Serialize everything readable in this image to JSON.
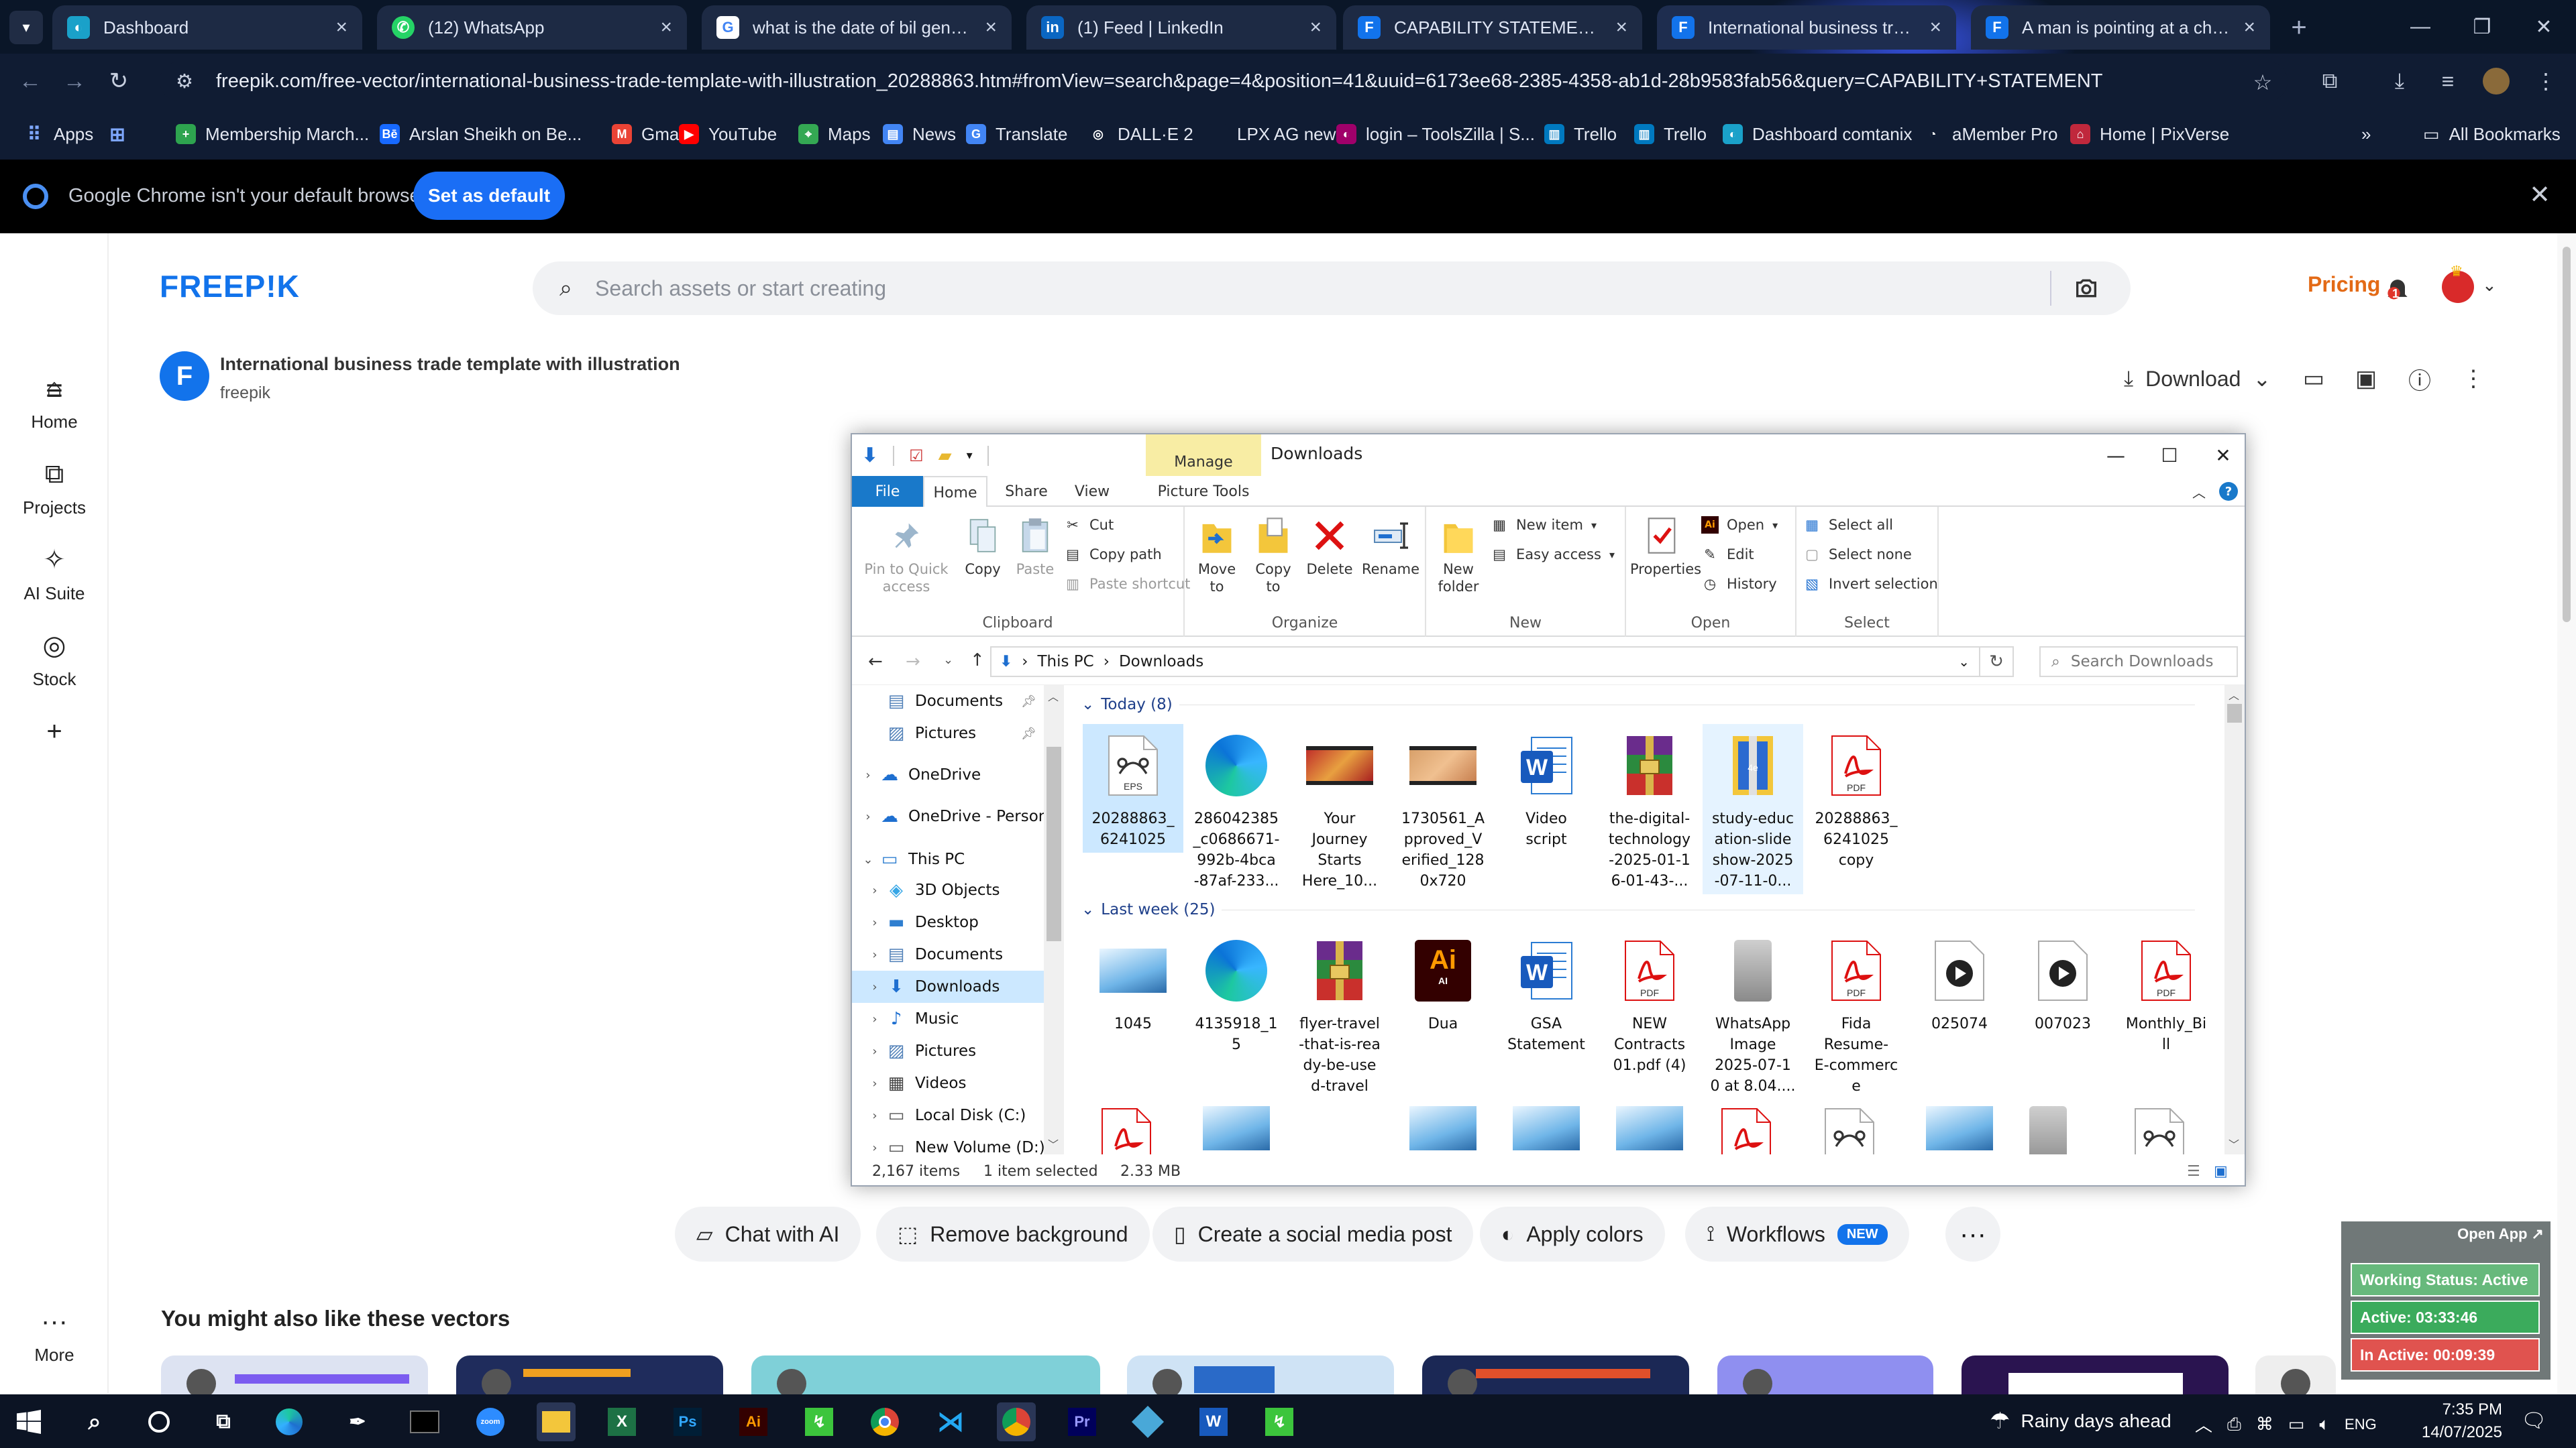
{
  "browser": {
    "tabs": [
      {
        "title": "Dashboard",
        "icon": "dashboard-favicon",
        "color": "#1aa1c9"
      },
      {
        "title": "(12) WhatsApp",
        "icon": "whatsapp-favicon",
        "color": "#25d366"
      },
      {
        "title": "what is the date of bil generati",
        "icon": "google-favicon",
        "color": "#ffffff"
      },
      {
        "title": "(1) Feed | LinkedIn",
        "icon": "linkedin-favicon",
        "color": "#0a66c2"
      },
      {
        "title": "CAPABILITY STATEMENT vecto",
        "icon": "freepik-favicon",
        "color": "#1273eb"
      },
      {
        "title": "International business trade te",
        "icon": "freepik-favicon",
        "color": "#1273eb"
      },
      {
        "title": "A man is pointing at a chart th",
        "icon": "freepik-favicon",
        "color": "#1273eb"
      }
    ],
    "active_tab": 5,
    "url": "freepik.com/free-vector/international-business-trade-template-with-illustration_20288863.htm#fromView=search&page=4&position=41&uuid=6173ee68-2385-4358-ab1d-28b9583fab56&query=CAPABILITY+STATEMENT",
    "bookmarks": [
      {
        "label": "Apps",
        "icon": "apps-grid-icon"
      },
      {
        "label": "",
        "icon": "grid-icon"
      },
      {
        "label": "Membership March...",
        "icon": "membership-icon"
      },
      {
        "label": "Arslan Sheikh on Be...",
        "icon": "behance-icon"
      },
      {
        "label": "Gmail",
        "icon": "gmail-icon"
      },
      {
        "label": "YouTube",
        "icon": "youtube-icon"
      },
      {
        "label": "Maps",
        "icon": "maps-icon"
      },
      {
        "label": "News",
        "icon": "news-icon"
      },
      {
        "label": "Translate",
        "icon": "translate-icon"
      },
      {
        "label": "DALL·E 2",
        "icon": "openai-icon"
      },
      {
        "label": "LPX AG new",
        "icon": "globe-icon"
      },
      {
        "label": "login – ToolsZilla | S...",
        "icon": "toolszilla-icon"
      },
      {
        "label": "Trello",
        "icon": "trello-icon"
      },
      {
        "label": "Trello",
        "icon": "trello-icon"
      },
      {
        "label": "Dashboard comtanix",
        "icon": "dashboard-icon"
      },
      {
        "label": "aMember Pro",
        "icon": "amember-icon"
      },
      {
        "label": "Home | PixVerse",
        "icon": "pixverse-icon"
      }
    ],
    "all_bookmarks": "All Bookmarks",
    "infobar": {
      "message": "Google Chrome isn't your default browser",
      "button": "Set as default"
    }
  },
  "freepik": {
    "logo": "FREEP!K",
    "search_placeholder": "Search assets or start creating",
    "pricing": "Pricing",
    "notifications": "1",
    "rail": [
      "Home",
      "Projects",
      "AI Suite",
      "Stock",
      "",
      "More"
    ],
    "asset": {
      "badge": "F",
      "title": "International business trade template with illustration",
      "author": "freepik"
    },
    "download": "Download",
    "actions": [
      "Chat with AI",
      "Remove background",
      "Create a social media post",
      "Apply colors",
      "Workflows"
    ],
    "new_badge": "NEW",
    "also_like": "You might also like these vectors",
    "accent": "#1273eb"
  },
  "explorer": {
    "title": "Downloads",
    "manage": "Manage",
    "ribbon_tabs": [
      "File",
      "Home",
      "Share",
      "View",
      "Picture Tools"
    ],
    "clipboard": {
      "pin": "Pin to Quick access",
      "copy": "Copy",
      "paste": "Paste",
      "cut": "Cut",
      "copy_path": "Copy path",
      "paste_shortcut": "Paste shortcut",
      "label": "Clipboard"
    },
    "organize": {
      "move": "Move to",
      "copy": "Copy to",
      "delete": "Delete",
      "rename": "Rename",
      "label": "Organize"
    },
    "new": {
      "folder": "New folder",
      "item": "New item",
      "easy": "Easy access",
      "label": "New"
    },
    "open": {
      "properties": "Properties",
      "open": "Open",
      "edit": "Edit",
      "history": "History",
      "label": "Open"
    },
    "select": {
      "all": "Select all",
      "none": "Select none",
      "invert": "Invert selection",
      "label": "Select"
    },
    "path": [
      "This PC",
      "Downloads"
    ],
    "search_placeholder": "Search Downloads",
    "nav": [
      {
        "label": "Documents",
        "icon": "documents-folder-icon",
        "indent": 1,
        "pin": true
      },
      {
        "label": "Pictures",
        "icon": "pictures-folder-icon",
        "indent": 1,
        "pin": true
      },
      {
        "label": "OneDrive",
        "icon": "onedrive-icon",
        "indent": 0
      },
      {
        "label": "OneDrive - Person",
        "icon": "onedrive-icon",
        "indent": 0
      },
      {
        "label": "This PC",
        "icon": "pc-icon",
        "indent": 0,
        "expanded": true
      },
      {
        "label": "3D Objects",
        "icon": "3d-objects-icon",
        "indent": 1
      },
      {
        "label": "Desktop",
        "icon": "desktop-folder-icon",
        "indent": 1
      },
      {
        "label": "Documents",
        "icon": "documents-folder-icon",
        "indent": 1
      },
      {
        "label": "Downloads",
        "icon": "downloads-folder-icon",
        "indent": 1,
        "selected": true
      },
      {
        "label": "Music",
        "icon": "music-folder-icon",
        "indent": 1
      },
      {
        "label": "Pictures",
        "icon": "pictures-folder-icon",
        "indent": 1
      },
      {
        "label": "Videos",
        "icon": "videos-folder-icon",
        "indent": 1
      },
      {
        "label": "Local Disk (C:)",
        "icon": "drive-icon",
        "indent": 1
      },
      {
        "label": "New Volume (D:)",
        "icon": "drive-icon",
        "indent": 1
      }
    ],
    "groups": [
      {
        "label": "Today (8)",
        "files": [
          {
            "name": "20288863_\n6241025",
            "type": "eps",
            "selected": true
          },
          {
            "name": "286042385\n_c0686671-\n992b-4bca\n-87af-233...",
            "type": "edge"
          },
          {
            "name": "Your\nJourney\nStarts\nHere_10...",
            "type": "video-red"
          },
          {
            "name": "1730561_A\npproved_V\nerified_128\n0x720",
            "type": "video-tan"
          },
          {
            "name": "Video\nscript",
            "type": "word"
          },
          {
            "name": "the-digital-\ntechnology\n-2025-01-1\n6-01-43-...",
            "type": "rar"
          },
          {
            "name": "study-educ\nation-slide\nshow-2025\n-07-11-0...",
            "type": "zip-blue",
            "hover": true
          },
          {
            "name": "20288863_\n6241025\ncopy",
            "type": "pdf"
          }
        ]
      },
      {
        "label": "Last week (25)",
        "files": [
          {
            "name": "1045",
            "type": "image-chart"
          },
          {
            "name": "4135918_1\n5",
            "type": "edge"
          },
          {
            "name": "flyer-travel\n-that-is-rea\ndy-be-use\nd-travel",
            "type": "rar"
          },
          {
            "name": "Dua",
            "type": "ai"
          },
          {
            "name": "GSA\nStatement",
            "type": "word"
          },
          {
            "name": "NEW\nContracts\n01.pdf (4)",
            "type": "pdf"
          },
          {
            "name": "WhatsApp\nImage\n2025-07-1\n0 at 8.04....",
            "type": "image-phone"
          },
          {
            "name": "Fida\nResume-\nE-commerc\ne",
            "type": "pdf"
          },
          {
            "name": "025074",
            "type": "media"
          },
          {
            "name": "007023",
            "type": "media"
          },
          {
            "name": "Monthly_Bi\nll",
            "type": "pdf"
          }
        ]
      }
    ],
    "status": {
      "items": "2,167 items",
      "selected": "1 item selected",
      "size": "2.33 MB"
    }
  },
  "monitor": {
    "open_app": "Open App ↗",
    "status": "Working Status: Active",
    "active": "Active: 03:33:46",
    "inactive": "In Active: 00:09:39"
  },
  "taskbar": {
    "weather": "Rainy days ahead",
    "lang": "ENG",
    "time": "7:35 PM",
    "date": "14/07/2025"
  }
}
